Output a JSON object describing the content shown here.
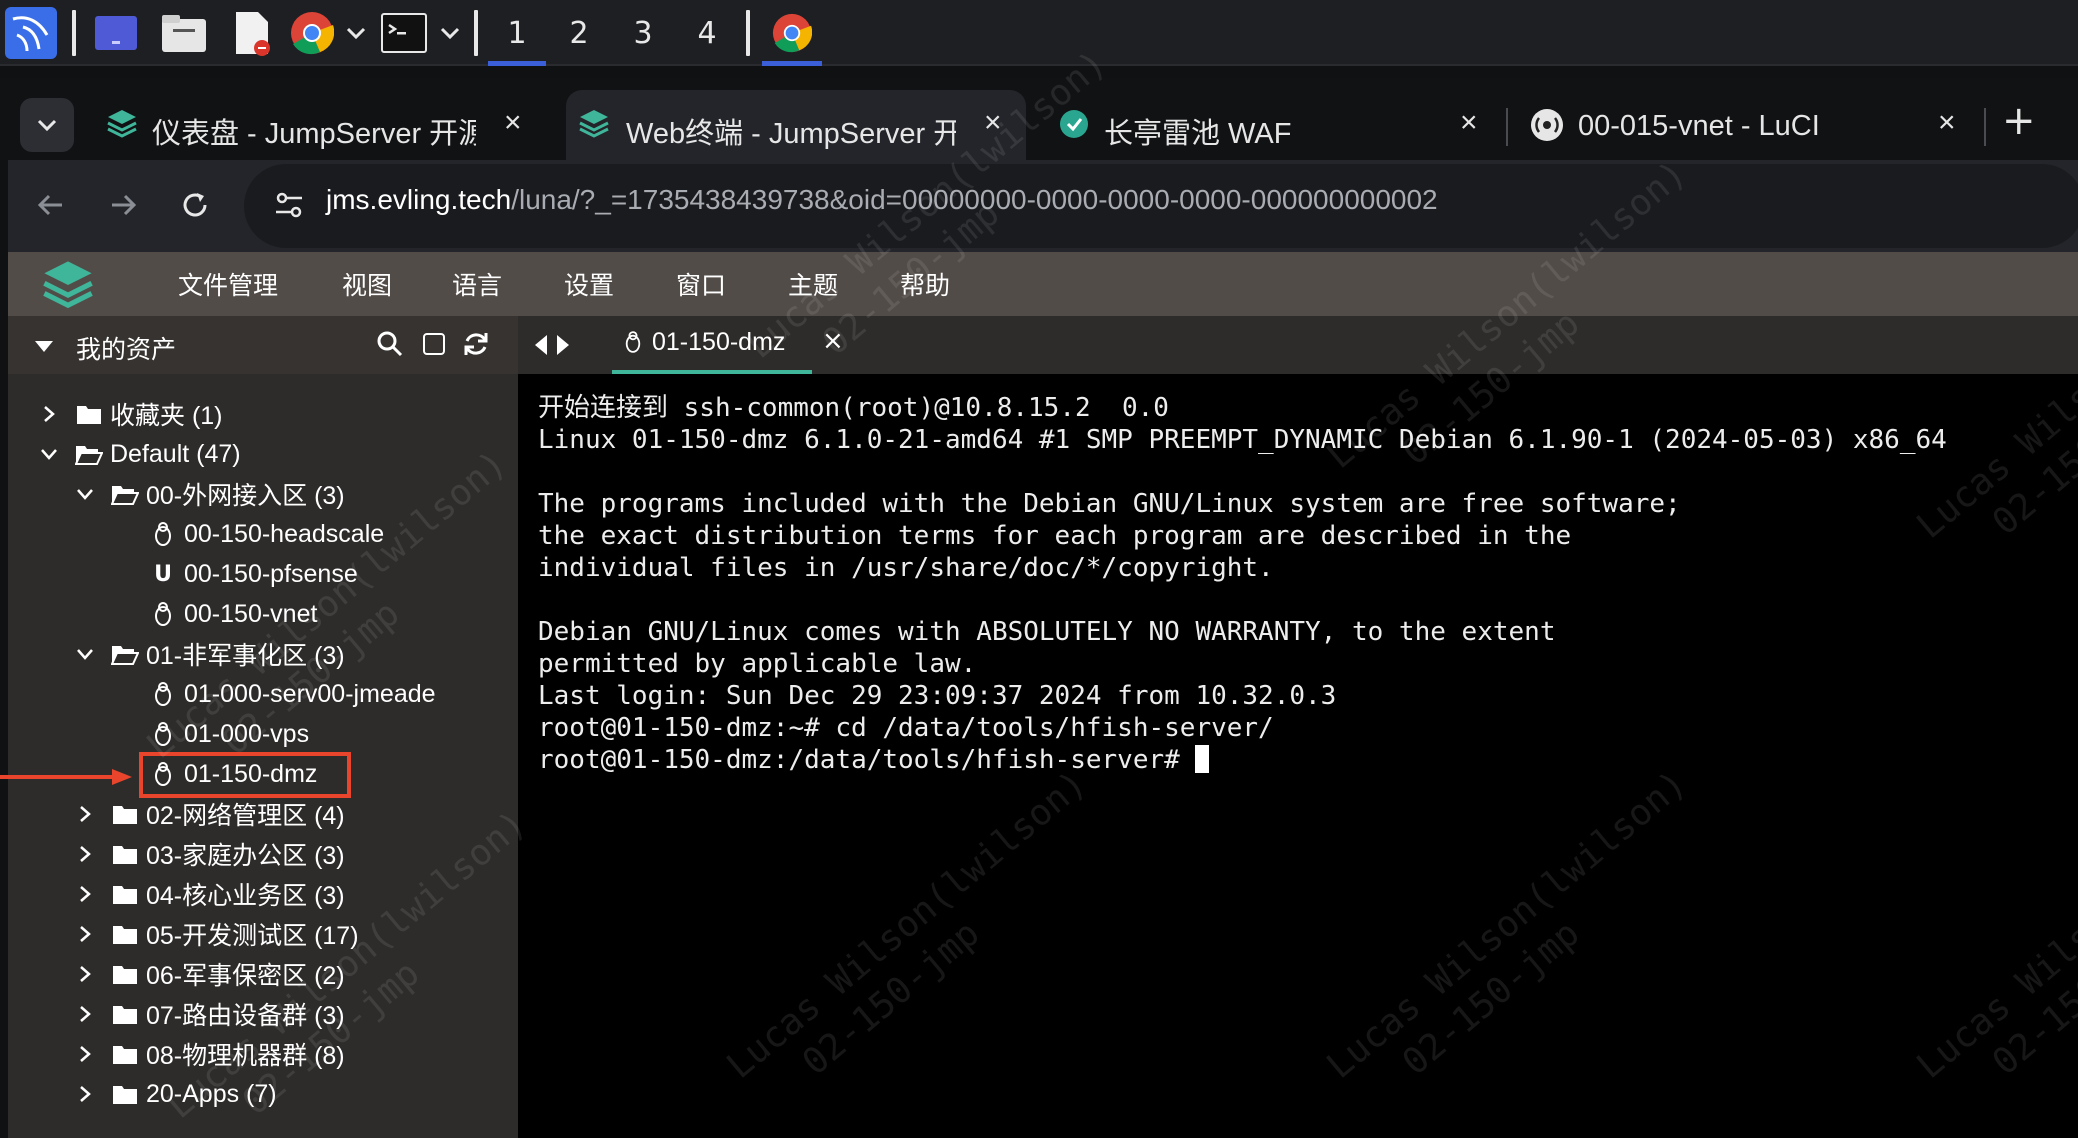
{
  "taskbar": {
    "workspaces": [
      "1",
      "2",
      "3",
      "4"
    ],
    "active_workspace": "1"
  },
  "browser": {
    "tabs": [
      {
        "title": "仪表盘 - JumpServer 开源",
        "icon": "jumpserver-icon",
        "active": false
      },
      {
        "title": "Web终端 - JumpServer 开",
        "icon": "jumpserver-icon",
        "active": true
      },
      {
        "title": "长亭雷池 WAF",
        "icon": "safeline-waf-icon",
        "active": false
      },
      {
        "title": "00-015-vnet - LuCI",
        "icon": "openwrt-icon",
        "active": false
      }
    ],
    "close_glyph": "×",
    "new_tab_glyph": "+",
    "url_host": "jms.evling.tech",
    "url_path": "/luna/?_=1735438439738&oid=00000000-0000-0000-0000-000000000002"
  },
  "app": {
    "menu": [
      "文件管理",
      "视图",
      "语言",
      "设置",
      "窗口",
      "主题",
      "帮助"
    ],
    "sidebar_title": "我的资产",
    "tree": [
      {
        "label": "收藏夹 (1)",
        "type": "folder",
        "expanded": false
      },
      {
        "label": "Default (47)",
        "type": "folder",
        "expanded": true
      },
      {
        "label": "00-外网接入区 (3)",
        "type": "folder",
        "expanded": true
      },
      {
        "label": "00-150-headscale",
        "type": "linux"
      },
      {
        "label": "00-150-pfsense",
        "type": "unix"
      },
      {
        "label": "00-150-vnet",
        "type": "linux"
      },
      {
        "label": "01-非军事化区 (3)",
        "type": "folder",
        "expanded": true
      },
      {
        "label": "01-000-serv00-jmeade",
        "type": "linux"
      },
      {
        "label": "01-000-vps",
        "type": "linux"
      },
      {
        "label": "01-150-dmz",
        "type": "linux",
        "highlighted": true
      },
      {
        "label": "02-网络管理区 (4)",
        "type": "folder",
        "expanded": false
      },
      {
        "label": "03-家庭办公区 (3)",
        "type": "folder",
        "expanded": false
      },
      {
        "label": "04-核心业务区 (3)",
        "type": "folder",
        "expanded": false
      },
      {
        "label": "05-开发测试区 (17)",
        "type": "folder",
        "expanded": false
      },
      {
        "label": "06-军事保密区 (2)",
        "type": "folder",
        "expanded": false
      },
      {
        "label": "07-路由设备群 (3)",
        "type": "folder",
        "expanded": false
      },
      {
        "label": "08-物理机器群 (8)",
        "type": "folder",
        "expanded": false
      },
      {
        "label": "20-Apps (7)",
        "type": "folder",
        "expanded": false
      }
    ],
    "session_tab": "01-150-dmz",
    "terminal_lines": [
      "开始连接到 ssh-common(root)@10.8.15.2  0.0",
      "Linux 01-150-dmz 6.1.0-21-amd64 #1 SMP PREEMPT_DYNAMIC Debian 6.1.90-1 (2024-05-03) x86_64",
      "",
      "The programs included with the Debian GNU/Linux system are free software;",
      "the exact distribution terms for each program are described in the",
      "individual files in /usr/share/doc/*/copyright.",
      "",
      "Debian GNU/Linux comes with ABSOLUTELY NO WARRANTY, to the extent",
      "permitted by applicable law.",
      "Last login: Sun Dec 29 23:09:37 2024 from 10.32.0.3",
      "root@01-150-dmz:~# cd /data/tools/hfish-server/"
    ],
    "prompt_line": "root@01-150-dmz:/data/tools/hfish-server# ",
    "watermark_lines": [
      "Lucas Wilson(lwilson)",
      "02-150-jmp"
    ]
  },
  "colors": {
    "highlight_box": "#e8452c",
    "app_menubar": "#524c48",
    "sidebar": "#2e2c2b",
    "terminal_bg": "#000000",
    "jumpserver_green": "#3fb59a"
  }
}
